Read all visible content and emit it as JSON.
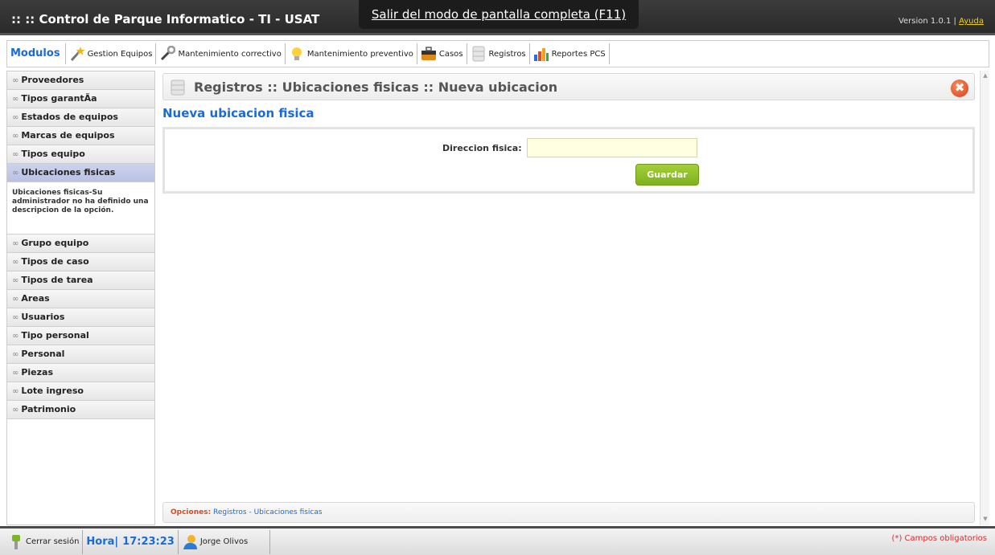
{
  "header": {
    "title": ":: :: Control de Parque Informatico - TI - USAT",
    "version": "Version 1.0.1 |",
    "help_link": "Ayuda",
    "fullscreen_banner": "Salir del modo de pantalla completa (F11)"
  },
  "modules": {
    "label": "Modulos",
    "items": [
      {
        "label": "Gestion Equipos",
        "icon": "magic-wand-icon"
      },
      {
        "label": "Mantenimiento correctivo",
        "icon": "wrench-icon"
      },
      {
        "label": "Mantenimiento preventivo",
        "icon": "lightbulb-icon"
      },
      {
        "label": "Casos",
        "icon": "briefcase-icon"
      },
      {
        "label": "Registros",
        "icon": "database-icon"
      },
      {
        "label": "Reportes PCS",
        "icon": "bar-chart-icon"
      }
    ]
  },
  "sidebar": {
    "items_top": [
      {
        "label": "Proveedores"
      },
      {
        "label": "Tipos garantÃa"
      },
      {
        "label": "Estados de equipos"
      },
      {
        "label": "Marcas de equipos"
      },
      {
        "label": "Tipos equipo"
      },
      {
        "label": "Ubicaciones fisicas",
        "active": true
      }
    ],
    "description": "Ubicaciones fisicas-Su administrador no ha definido una descripcion de la opción.",
    "items_bottom": [
      {
        "label": "Grupo equipo"
      },
      {
        "label": "Tipos de caso"
      },
      {
        "label": "Tipos de tarea"
      },
      {
        "label": "Areas"
      },
      {
        "label": "Usuarios"
      },
      {
        "label": "Tipo personal"
      },
      {
        "label": "Personal"
      },
      {
        "label": "Piezas"
      },
      {
        "label": "Lote ingreso"
      },
      {
        "label": "Patrimonio"
      }
    ]
  },
  "main": {
    "breadcrumb": "Registros :: Ubicaciones fisicas :: Nueva ubicacion",
    "page_title": "Nueva ubicacion fisica",
    "form": {
      "label": "Direccion fisica:",
      "value": "",
      "save_label": "Guardar"
    },
    "options": {
      "label": "Opciones:",
      "link1": "Registros",
      "separator": "-",
      "link2": "Ubicaciones fisicas"
    }
  },
  "footer": {
    "logout_label": "Cerrar sesión",
    "clock_label": "Hora|",
    "clock_value": "17:23:23",
    "user_name": "Jorge Olivos",
    "required_note": "(*) Campos obligatorios"
  },
  "colors": {
    "accent_blue": "#1a6bd6",
    "save_green": "#8dbd2a",
    "header_dark": "#333333",
    "input_bg": "#ffffe1"
  }
}
